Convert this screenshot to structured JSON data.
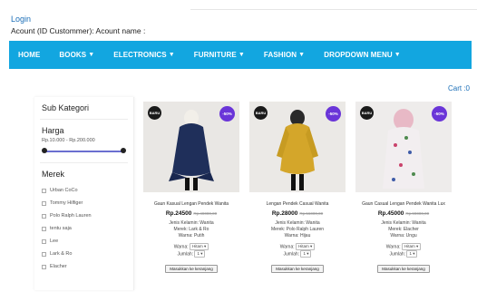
{
  "header": {
    "login_label": "Login",
    "account_text": "Acount (ID Custommer): Acount name :",
    "cart_label": "Cart :0"
  },
  "nav": {
    "items": [
      {
        "label": "HOME",
        "has_caret": false
      },
      {
        "label": "BOOKS",
        "has_caret": true
      },
      {
        "label": "ELECTRONICS",
        "has_caret": true
      },
      {
        "label": "FURNITURE",
        "has_caret": true
      },
      {
        "label": "FASHION",
        "has_caret": true
      },
      {
        "label": "DROPDOWN MENU",
        "has_caret": true
      }
    ],
    "caret_glyph": "▼"
  },
  "sidebar": {
    "category_title": "Sub Kategori",
    "price_title": "Harga",
    "price_range": "Rp.10.000 - Rp.200.000",
    "brand_title": "Merek",
    "brands": [
      "Urban CoCo",
      "Tommy Hilfiger",
      "Polo Ralph Lauren",
      "tentu saja",
      "Lee",
      "Lark & Ro",
      "Elacher"
    ]
  },
  "colors": {
    "nav_bg": "#12a6e0",
    "discount_badge": "#6a35d8",
    "new_badge": "#1a1a1a",
    "slider": "#6a6fd0"
  },
  "products": [
    {
      "name": "Gaun Kasual Lengan Pendek Wanita",
      "price": "Rp.24500",
      "old_price": "Rp.49000,00",
      "new_badge": "BARU",
      "discount_badge": "-50%",
      "gender": "Jenis Kelamin: Wanita",
      "brand": "Merek: Lark & Ro",
      "color": "Warna: Putih",
      "color_label": "Warna:",
      "color_option": "Hitam",
      "qty_label": "Jumlah:",
      "qty_option": "1",
      "button": "Masukkan ke keranjang",
      "garment_color": "#1f2f5a",
      "scarf_color": "#f1ede6"
    },
    {
      "name": "Lengan Pendek Casual Wanita",
      "price": "Rp.28000",
      "old_price": "Rp.56000,00",
      "new_badge": "BARU",
      "discount_badge": "-50%",
      "gender": "Jenis Kelamin: Wanita",
      "brand": "Merek: Polo Ralph Lauren",
      "color": "Warna: Hijau",
      "color_label": "Warna:",
      "color_option": "Hitam",
      "qty_label": "Jumlah:",
      "qty_option": "1",
      "button": "Masukkan ke keranjang",
      "garment_color": "#d4a62a",
      "scarf_color": "#2a2a2a"
    },
    {
      "name": "Gaun Casual Lengan Pendek Wanita Lux",
      "price": "Rp.45000",
      "old_price": "Rp.90000,00",
      "new_badge": "BARU",
      "discount_badge": "-50%",
      "gender": "Jenis Kelamin: Wanita",
      "brand": "Merek: Elacher",
      "color": "Warna: Ungu",
      "color_label": "Warna:",
      "color_option": "Hitam",
      "qty_label": "Jumlah:",
      "qty_option": "1",
      "button": "Masukkan ke keranjang",
      "garment_color": "#efe9ea",
      "scarf_color": "#e8b9c6"
    }
  ]
}
